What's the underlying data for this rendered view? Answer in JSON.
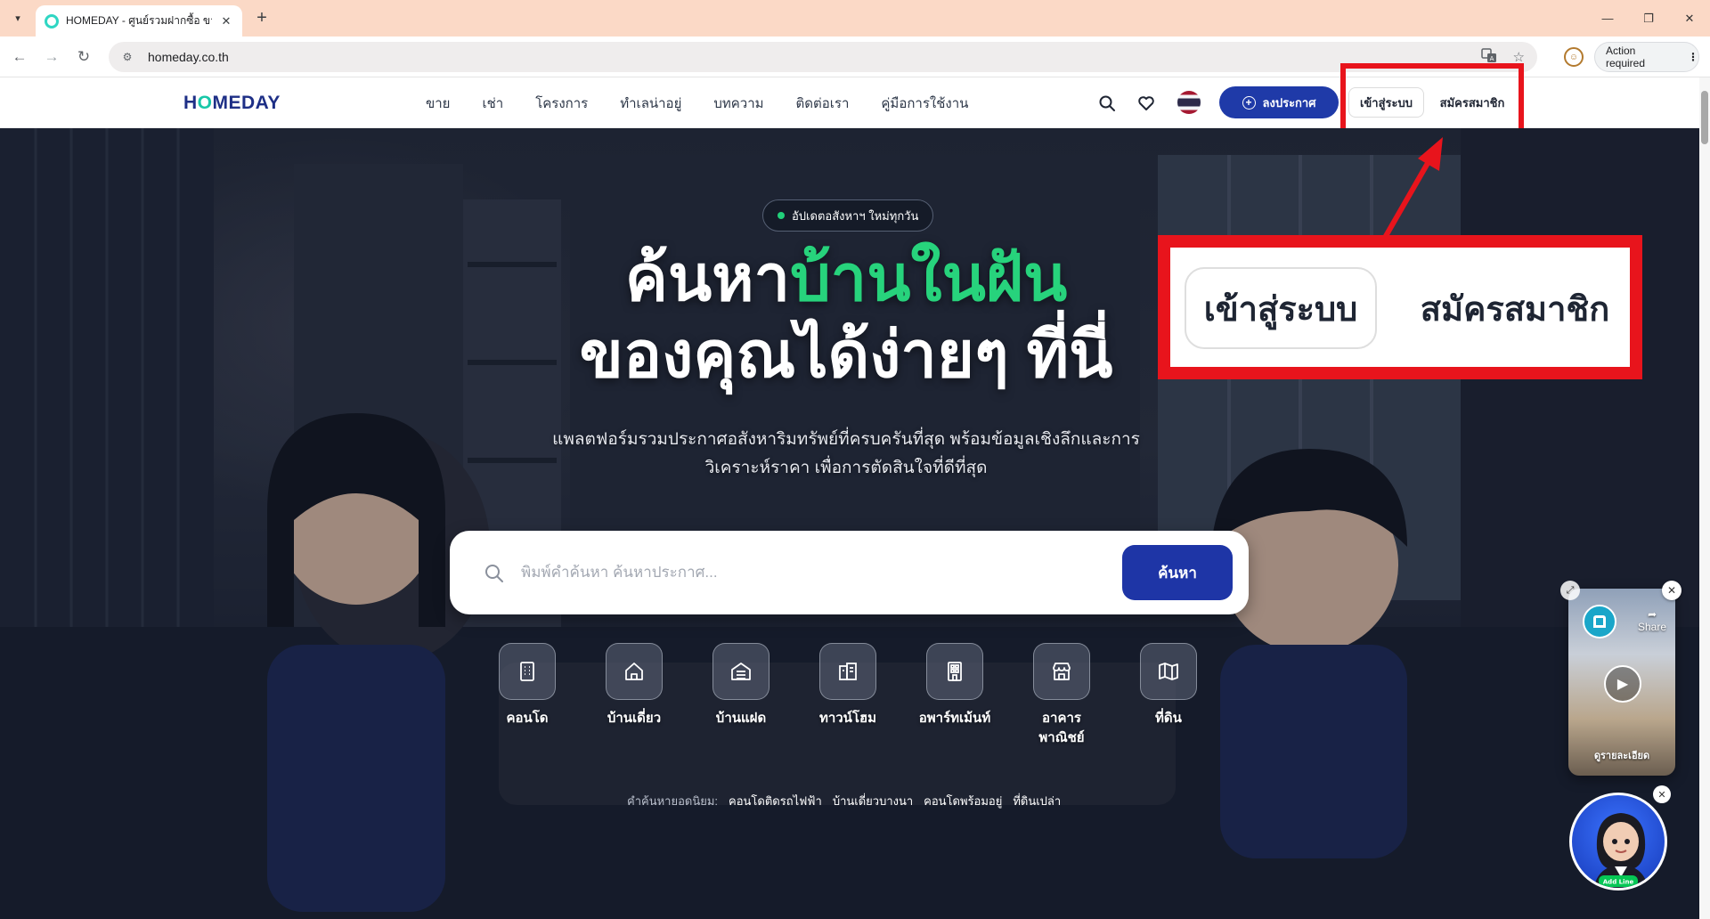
{
  "browser": {
    "tab_title": "HOMEDAY - ศูนย์รวมฝากซื้อ ขาย",
    "url": "homeday.co.th",
    "action_required": "Action required"
  },
  "header": {
    "logo_pre": "H",
    "logo_o": "O",
    "logo_post": "MEDAY",
    "nav": [
      "ขาย",
      "เช่า",
      "โครงการ",
      "ทำเลน่าอยู่",
      "บทความ",
      "ติดต่อเรา",
      "คู่มือการใช้งาน"
    ],
    "post_button": "ลงประกาศ",
    "login_button": "เข้าสู่ระบบ",
    "register_button": "สมัครสมาชิก"
  },
  "hero": {
    "badge": "อัปเดตอสังหาฯ ใหม่ทุกวัน",
    "headline_part1": "ค้นหา",
    "headline_highlight": "บ้านในฝัน",
    "headline_line2": "ของคุณได้ง่ายๆ ที่นี่",
    "subtitle_line1": "แพลตฟอร์มรวมประกาศอสังหาริมทรัพย์ที่ครบครันที่สุด พร้อมข้อมูลเชิงลึกและการ",
    "subtitle_line2": "วิเคราะห์ราคา เพื่อการตัดสินใจที่ดีที่สุด",
    "search_placeholder": "พิมพ์คำค้นหา ค้นหาประกาศ...",
    "search_button": "ค้นหา",
    "categories": [
      {
        "label": "คอนโด",
        "icon": "condo-building-icon"
      },
      {
        "label": "บ้านเดี่ยว",
        "icon": "house-icon"
      },
      {
        "label": "บ้านแฝด",
        "icon": "twin-house-icon"
      },
      {
        "label": "ทาวน์โฮม",
        "icon": "townhome-icon"
      },
      {
        "label": "อพาร์ทเม้นท์",
        "icon": "apartment-icon"
      },
      {
        "label": "อาคาร\nพาณิชย์",
        "icon": "store-icon"
      },
      {
        "label": "ที่ดิน",
        "icon": "map-icon"
      }
    ],
    "popular_label": "คำค้นหายอดนิยม:",
    "popular_terms": [
      "คอนโดติดรถไฟฟ้า",
      "บ้านเดี่ยวบางนา",
      "คอนโดพร้อมอยู่",
      "ที่ดินเปล่า"
    ]
  },
  "callout": {
    "login": "เข้าสู่ระบบ",
    "register": "สมัครสมาชิก",
    "highlight_color": "#e8141c"
  },
  "widgets": {
    "video_share": "Share",
    "video_detail": "ดูรายละเอียด",
    "line_badge": "Add Line"
  },
  "colors": {
    "brand_navy": "#1e35a6",
    "accent_green": "#27d37c",
    "logo_teal": "#18c7a8"
  }
}
